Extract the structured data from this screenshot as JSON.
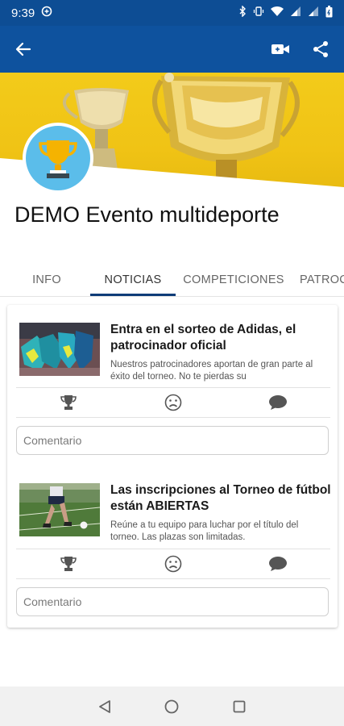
{
  "status_bar": {
    "time": "9:39"
  },
  "app_bar": {
    "back_icon": "arrow-back-icon",
    "video_icon": "video-camera-icon",
    "share_icon": "share-icon"
  },
  "colors": {
    "primary": "#0e529e",
    "status": "#0d4d94",
    "banner": "#f0c315",
    "avatar_bg": "#5bbdea",
    "tab_indicator": "#0e3c78"
  },
  "event": {
    "title": "DEMO Evento multideporte"
  },
  "tabs": [
    {
      "label": "INFO",
      "active": false
    },
    {
      "label": "NOTICIAS",
      "active": true
    },
    {
      "label": "COMPETICIONES",
      "active": false
    },
    {
      "label": "PATROCINADORES",
      "active": false
    }
  ],
  "news": [
    {
      "title": "Entra en el sorteo de Adidas, el patrocinador oficial",
      "summary": "Nuestros patrocinadores aportan de gran parte al éxito del torneo. No te pierdas su",
      "comment_placeholder": "Comentario"
    },
    {
      "title": "Las inscripciones al Torneo de fútbol están ABIERTAS",
      "summary": "Reúne a tu equipo para luchar por el título del torneo. Las plazas son limitadas.",
      "comment_placeholder": "Comentario"
    }
  ]
}
